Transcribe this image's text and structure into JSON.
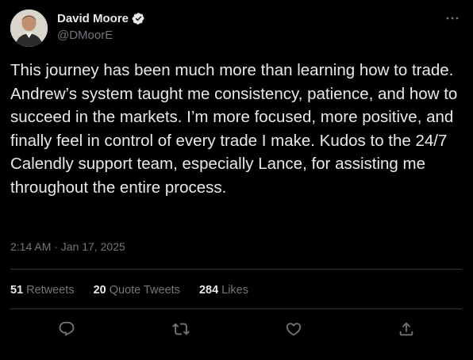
{
  "user": {
    "display_name": "David Moore",
    "handle": "@DMoorE",
    "verified": true
  },
  "tweet": {
    "text": "This journey has been much more than learning how to trade. Andrew’s system taught me consistency, patience, and how to succeed in the markets. I’m more focused, more positive, and finally feel in control of every trade I make. Kudos to the 24/7 Calendly support team, especially Lance, for assisting me throughout the entire process.",
    "timestamp": "2:14 AM · Jan 17, 2025"
  },
  "stats": {
    "retweets_count": "51",
    "retweets_label": "Retweets",
    "quotes_count": "20",
    "quotes_label": "Quote Tweets",
    "likes_count": "284",
    "likes_label": "Likes"
  },
  "icons": {
    "more": "more-icon",
    "reply": "reply-icon",
    "retweet": "retweet-icon",
    "like": "heart-icon",
    "share": "share-icon",
    "verified": "verified-badge-icon"
  },
  "colors": {
    "background": "#000000",
    "text": "#e7e9ea",
    "muted": "#71767b",
    "divider": "#2f3336"
  }
}
